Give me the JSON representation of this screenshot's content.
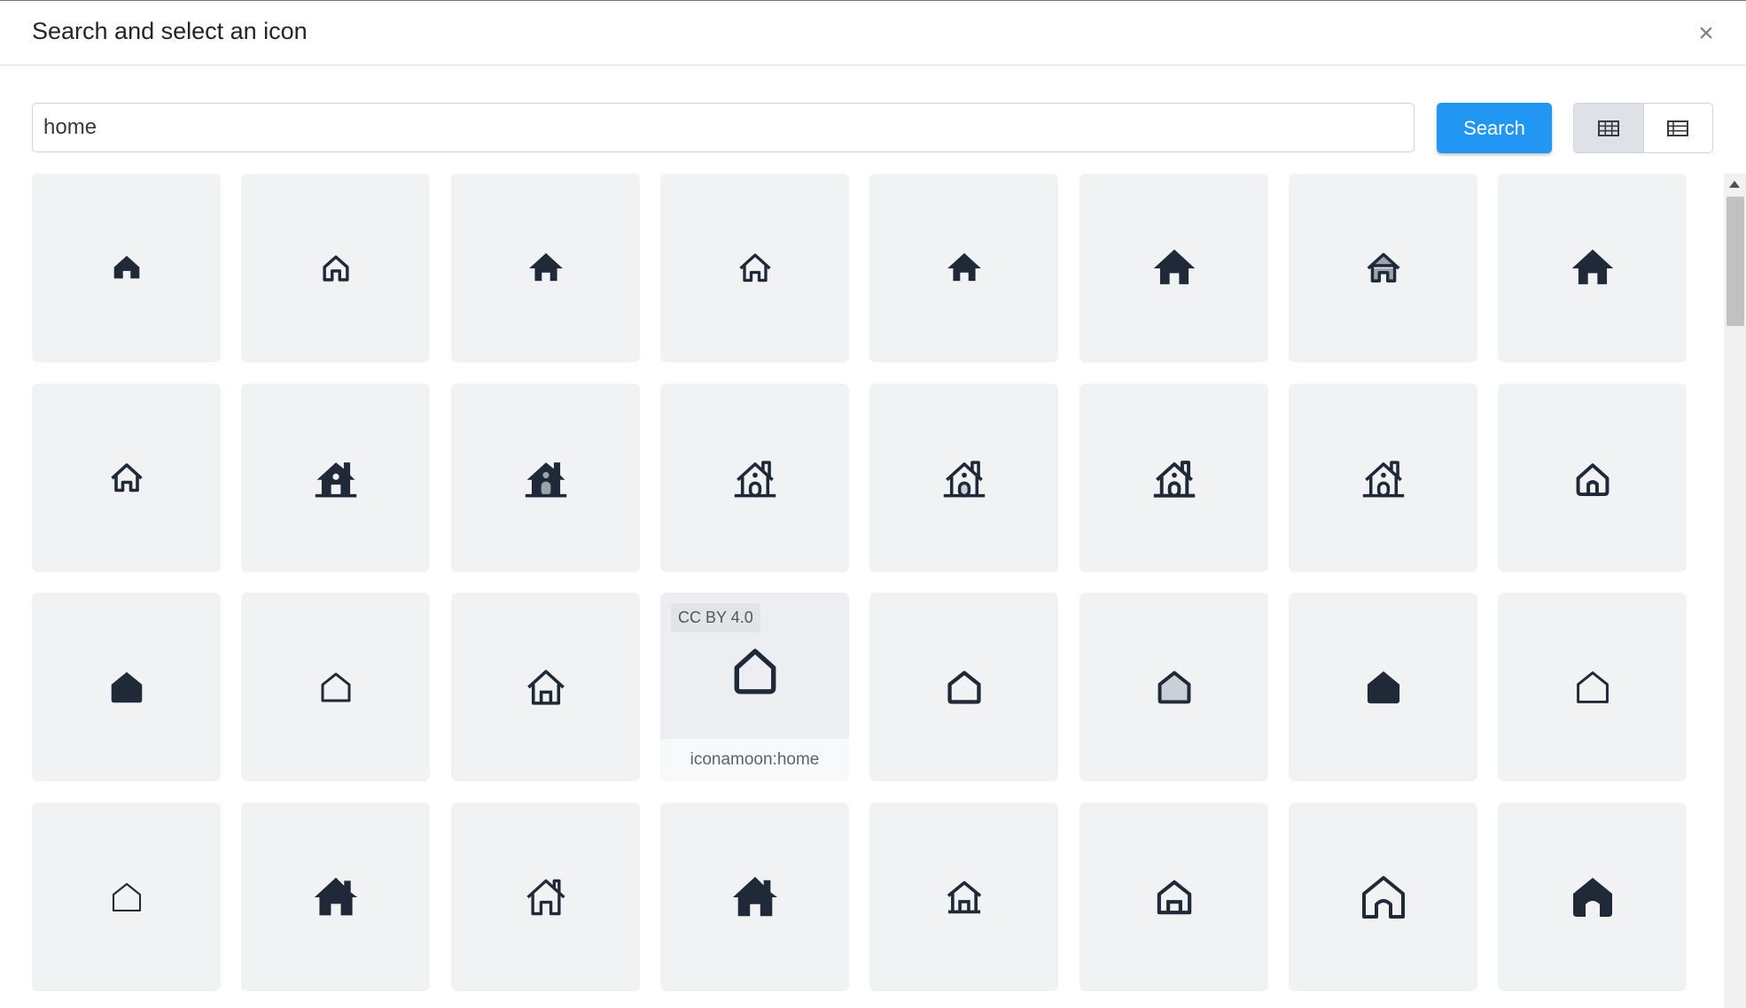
{
  "dialog": {
    "title": "Search and select an icon",
    "close_label": "×"
  },
  "search": {
    "value": "home",
    "button_label": "Search"
  },
  "view": {
    "grid_icon": "grid-view-icon",
    "list_icon": "list-view-icon",
    "active": "grid"
  },
  "hover_tile": {
    "license": "CC BY 4.0",
    "icon_id": "iconamoon:home"
  },
  "colors": {
    "accent": "#2196f3",
    "icon": "#1f2937",
    "tile_bg": "#f1f2f4"
  },
  "icons": [
    "home-icon",
    "home-outline-icon",
    "home-icon",
    "home-outline-icon",
    "home-icon",
    "home-icon",
    "home-duotone-icon",
    "home-icon",
    "home-outline-icon",
    "house-chimney-icon",
    "house-chimney-icon",
    "house-chimney-outline-icon",
    "house-chimney-outline-icon",
    "house-chimney-outline-icon",
    "house-chimney-outline-icon",
    "home-round-outline-icon",
    "home-solid-icon",
    "home-outline-icon",
    "home-door-outline-icon",
    "home-outline-icon",
    "home-outline-icon",
    "home-duotone-icon",
    "home-solid-icon",
    "home-outline-icon",
    "home-thin-outline-icon",
    "home-icon",
    "home-outline-icon",
    "home-icon",
    "home-outline-icon",
    "home-outline-icon",
    "home-outline-icon",
    "home-icon"
  ]
}
